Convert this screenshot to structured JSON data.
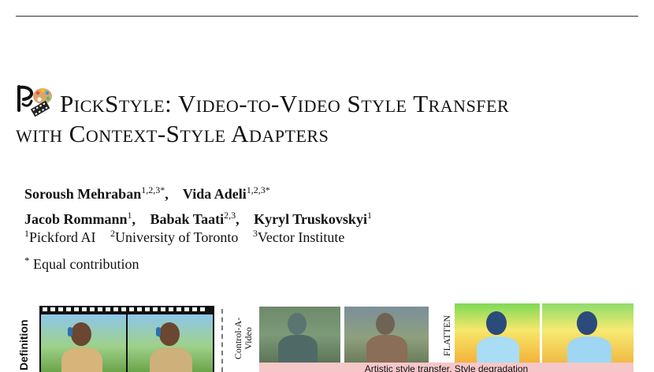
{
  "header": {
    "title_line1": "PickStyle: Video-to-Video Style Transfer",
    "title_line2": "with Context-Style Adapters"
  },
  "authors": [
    {
      "name": "Soroush Mehraban",
      "sup": "1,2,3*"
    },
    {
      "name": "Vida Adeli",
      "sup": "1,2,3*"
    },
    {
      "name": "Jacob Rommann",
      "sup": "1"
    },
    {
      "name": "Babak Taati",
      "sup": "2,3"
    },
    {
      "name": "Kyryl Truskovskyi",
      "sup": "1"
    }
  ],
  "affiliations": [
    {
      "num": "1",
      "name": "Pickford AI"
    },
    {
      "num": "2",
      "name": "University of Toronto"
    },
    {
      "num": "3",
      "name": "Vector Institute"
    }
  ],
  "note": {
    "mark": "*",
    "text": "Equal contribution"
  },
  "figure": {
    "side_label": "Definition",
    "method_label_1_line1": "Control-A-",
    "method_label_1_line2": "Video",
    "method_label_2": "FLATTEN",
    "banner": "Artistic style transfer, Style degradation"
  },
  "colors": {
    "banner": "#f6c7c9",
    "rule": "#333333"
  },
  "icons": [
    "pickstyle-logo-icon",
    "palette-icon",
    "filmstrip-icon"
  ]
}
